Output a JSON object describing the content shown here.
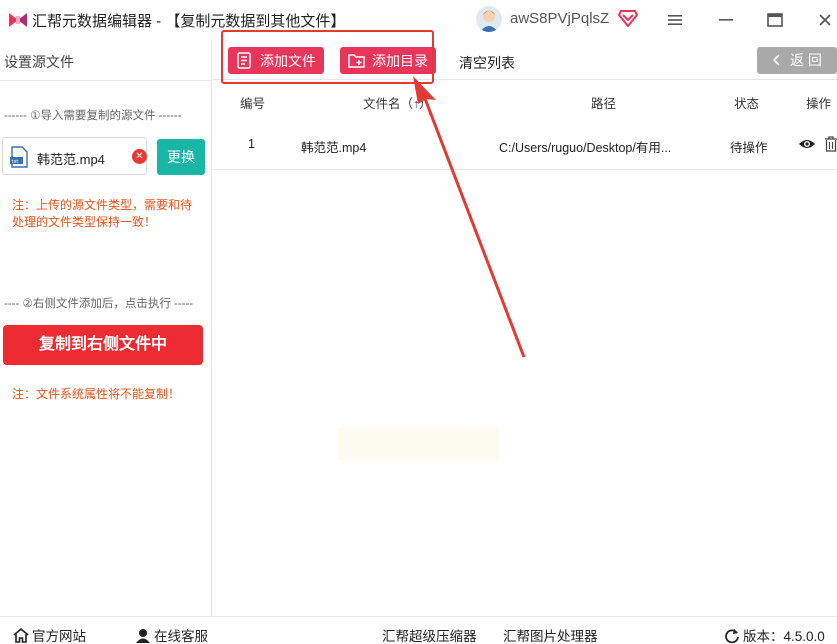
{
  "window": {
    "title": "汇帮元数据编辑器 - 【复制元数据到其他文件】",
    "username": "awS8PVjPqlsZ"
  },
  "sidebar": {
    "heading": "设置源文件",
    "section1": "------ ①导入需要复制的源文件 ------",
    "file_name": "韩范范.mp4",
    "replace_label": "更换",
    "note1": "注：上传的源文件类型，需要和待处理的文件类型保持一致！",
    "section2": "---- ②右侧文件添加后，点击执行 -----",
    "copy_label": "复制到右侧文件中",
    "note2": "注：文件系统属性将不能复制！"
  },
  "toolbar": {
    "add_file_label": "添加文件",
    "add_dir_label": "添加目录",
    "clear_label": "清空列表",
    "back_label": "返 回"
  },
  "table": {
    "headers": {
      "index": "编号",
      "filename": "文件名（↑）",
      "path": "路径",
      "status": "状态",
      "action": "操作"
    },
    "rows": [
      {
        "index": "1",
        "filename": "韩范范.mp4",
        "path": "C:/Users/ruguo/Desktop/有用...",
        "status": "待操作"
      }
    ]
  },
  "footer": {
    "website": "官方网站",
    "support": "在线客服",
    "compressor": "汇帮超级压缩器",
    "image_tool": "汇帮图片处理器",
    "version": "版本：4.5.0.0"
  },
  "colors": {
    "accent_pink": "#e8365a",
    "accent_red": "#ed2b33",
    "teal": "#19b6a6",
    "note_orange": "#e8551f",
    "highlight_red": "#e23a35"
  },
  "icons": [
    "app-logo-icon",
    "avatar-icon",
    "vip-diamond-icon",
    "menu-icon",
    "minimize-icon",
    "maximize-icon",
    "close-icon",
    "file-add-icon",
    "folder-add-icon",
    "chevron-left-icon",
    "eye-icon",
    "trash-icon",
    "home-icon",
    "support-icon",
    "refresh-icon",
    "video-file-icon"
  ]
}
